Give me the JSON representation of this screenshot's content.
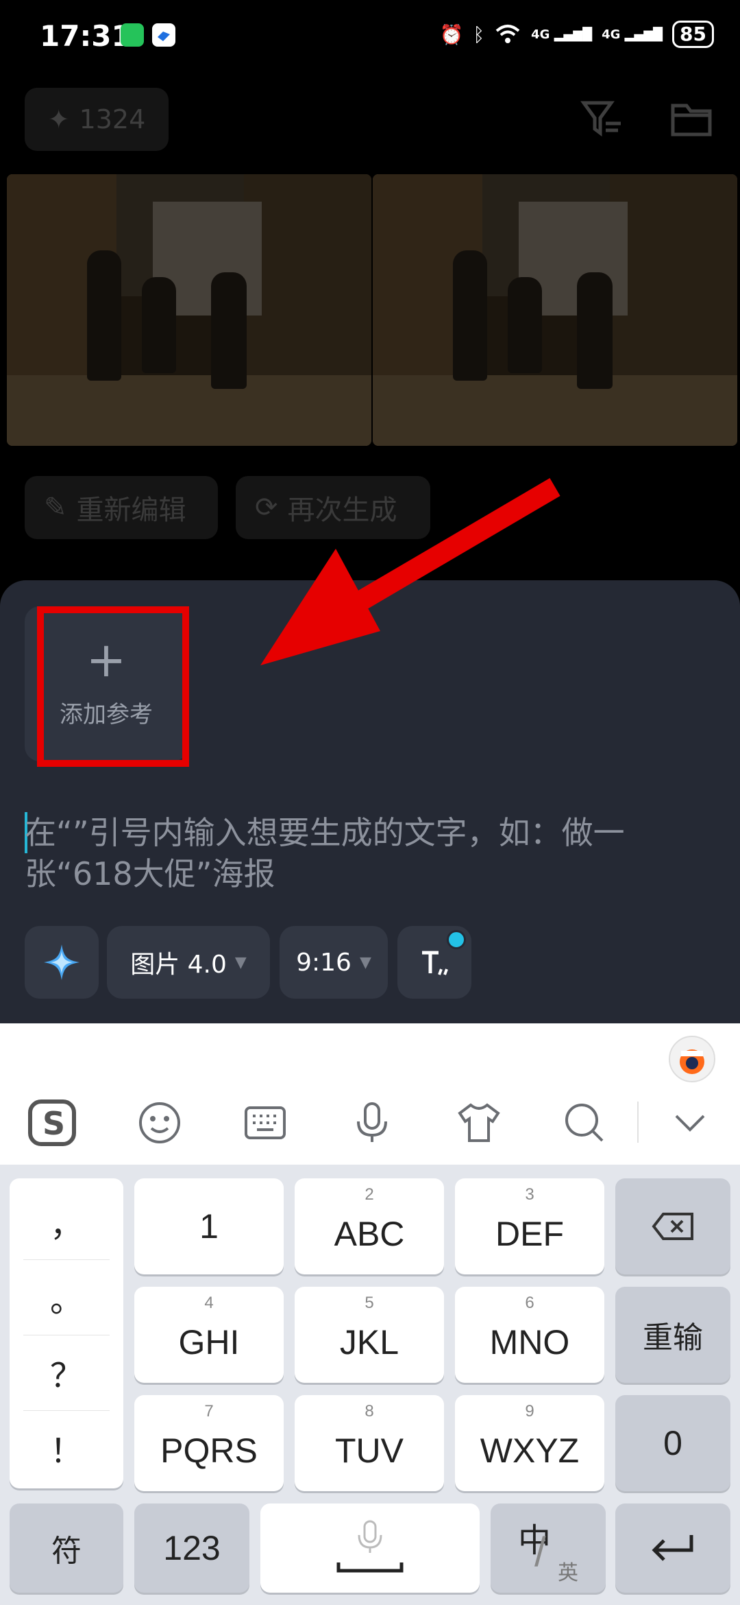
{
  "status_bar": {
    "time": "17:31",
    "network_1": "4G",
    "network_2": "4G",
    "battery": "85"
  },
  "header": {
    "credits": "1324",
    "icons": [
      "filter-icon",
      "folder-icon"
    ]
  },
  "result_actions": {
    "re_edit": "重新编辑",
    "regenerate": "再次生成"
  },
  "composer": {
    "add_reference": "添加参考",
    "prompt_placeholder": "在“”引号内输入想要生成的文字，如：做一张“618大促”海报",
    "model_chip": "图片 4.0",
    "ratio_chip": "9:16"
  },
  "keyboard": {
    "punctuation": [
      "，",
      "。",
      "？",
      "！"
    ],
    "keys": [
      {
        "sup": "",
        "main": "1"
      },
      {
        "sup": "2",
        "main": "ABC"
      },
      {
        "sup": "3",
        "main": "DEF"
      },
      {
        "sup": "4",
        "main": "GHI"
      },
      {
        "sup": "5",
        "main": "JKL"
      },
      {
        "sup": "6",
        "main": "MNO"
      },
      {
        "sup": "7",
        "main": "PQRS"
      },
      {
        "sup": "8",
        "main": "TUV"
      },
      {
        "sup": "9",
        "main": "WXYZ"
      }
    ],
    "reinput": "重输",
    "zero": "0",
    "symbols": "符",
    "numbers": "123",
    "lang_main": "中",
    "lang_sub": "英"
  },
  "colors": {
    "sheet_bg": "#252934",
    "accent": "#23c1e6",
    "annotation_red": "#e60000"
  }
}
